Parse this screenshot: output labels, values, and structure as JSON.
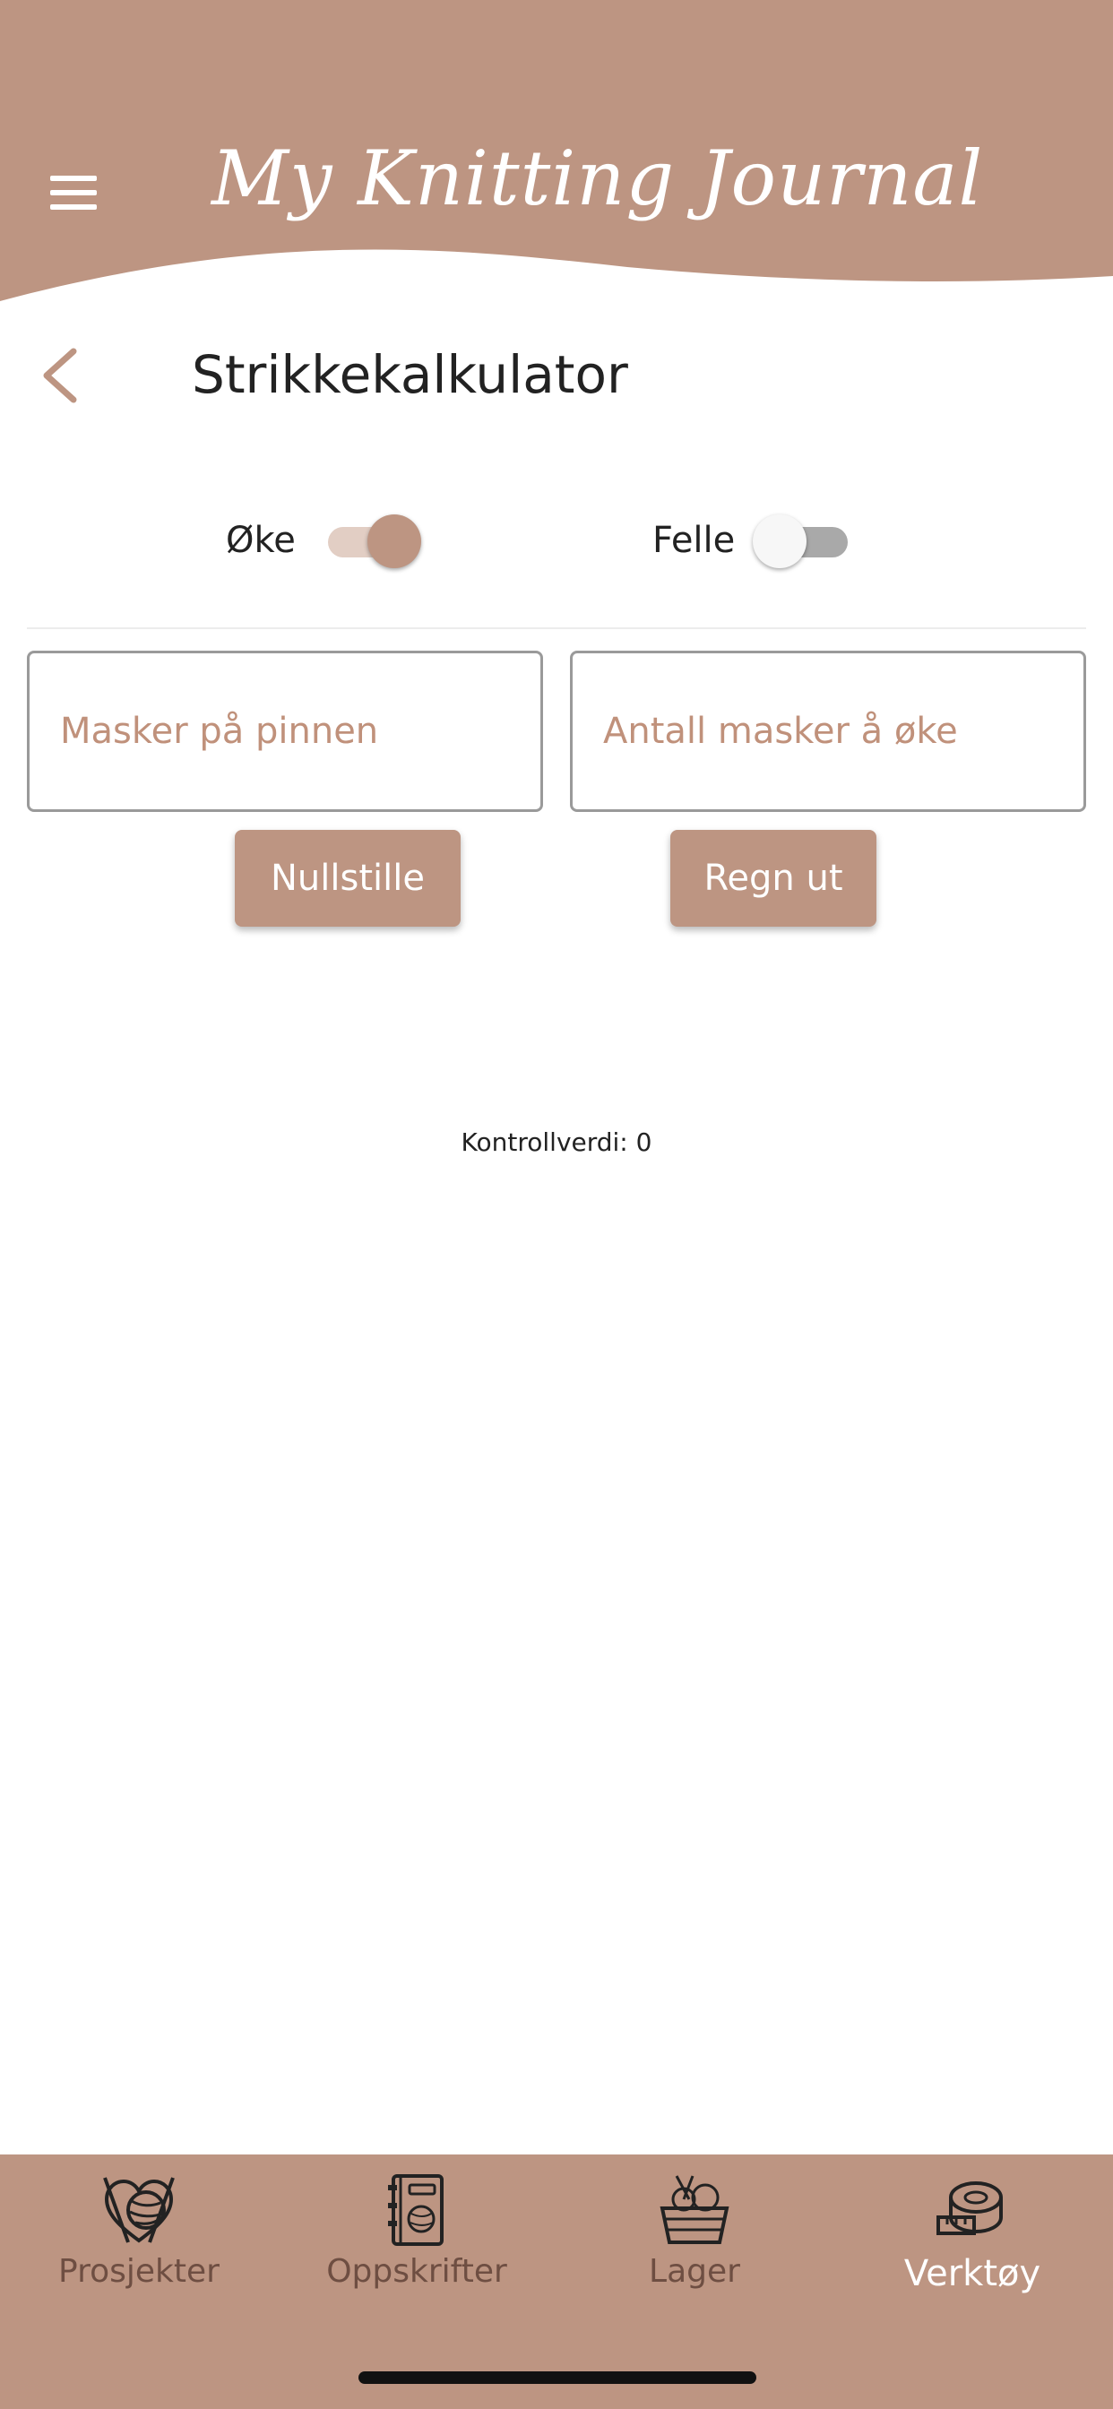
{
  "header": {
    "app_title": "My Knitting Journal",
    "brand_color": "#bd9582"
  },
  "page": {
    "title": "Strikkekalkulator"
  },
  "toggles": {
    "increase": {
      "label": "Øke",
      "on": true
    },
    "decrease": {
      "label": "Felle",
      "on": false
    }
  },
  "inputs": {
    "stitches_on_needle": {
      "placeholder": "Masker på pinnen",
      "value": ""
    },
    "stitches_to_increase": {
      "placeholder": "Antall masker å øke",
      "value": ""
    }
  },
  "buttons": {
    "reset_label": "Nullstille",
    "calculate_label": "Regn ut"
  },
  "result": {
    "control_value_text": "Kontrollverdi: 0"
  },
  "bottom_nav": {
    "items": [
      {
        "label": "Prosjekter",
        "icon": "yarn-ball-icon",
        "active": false
      },
      {
        "label": "Oppskrifter",
        "icon": "pattern-book-icon",
        "active": false
      },
      {
        "label": "Lager",
        "icon": "yarn-basket-icon",
        "active": false
      },
      {
        "label": "Verktøy",
        "icon": "measuring-tape-icon",
        "active": true
      }
    ]
  }
}
